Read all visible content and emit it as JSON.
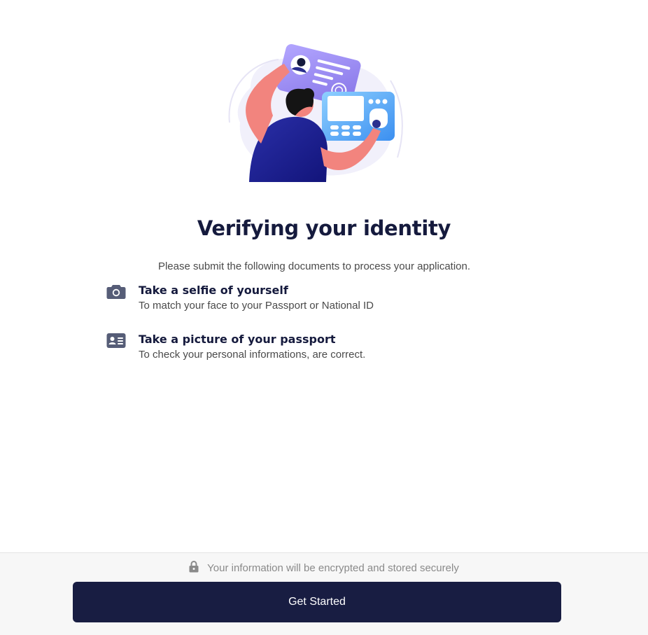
{
  "page": {
    "title": "Verifying your identity",
    "intro": "Please submit the following documents to process your application."
  },
  "steps": [
    {
      "icon": "camera-icon",
      "title": "Take a selfie of yourself",
      "description": "To match your face to your Passport or National ID"
    },
    {
      "icon": "id-card-icon",
      "title": "Take a picture of your passport",
      "description": "To check your personal informations, are correct."
    }
  ],
  "footer": {
    "secure_note": "Your information will be encrypted and stored securely",
    "cta_label": "Get Started"
  },
  "colors": {
    "primary": "#181d42",
    "heading": "#151a3d",
    "body_text": "#4a4a4a",
    "muted_text": "#8a8a8a",
    "footer_bg": "#f7f7f7",
    "icon": "#565d77",
    "illustration_card": "#9b8ef0",
    "illustration_terminal": "#5aaaf5",
    "illustration_skin": "#f2847e",
    "illustration_shirt": "#1c1f8a"
  }
}
